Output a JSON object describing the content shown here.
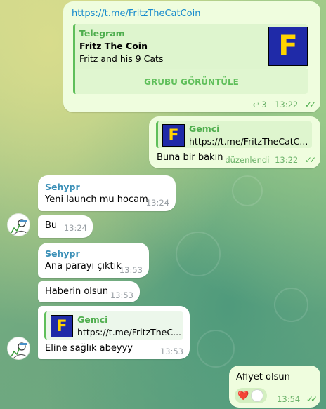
{
  "messages": {
    "m1": {
      "link": "https://t.me/FritzTheCatCoin",
      "preview_site": "Telegram",
      "preview_title": "Fritz The Coin",
      "preview_desc": "Fritz and his 9 Cats",
      "action": "GRUBU GÖRÜNTÜLE",
      "replies": "3",
      "time": "13:22",
      "logo_letter": "F"
    },
    "m2": {
      "reply_name": "Gemci",
      "reply_text": "https://t.me/FritzTheCatC...",
      "text": "Buna bir bakın",
      "edited": "düzenlendi",
      "time": "13:22",
      "logo_letter": "F"
    },
    "m3": {
      "name": "Sehypr",
      "text": "Yeni launch mu hocam",
      "time": "13:24"
    },
    "m4": {
      "text": "Bu",
      "time": "13:24"
    },
    "m5": {
      "name": "Sehypr",
      "text": "Ana parayı çıktık",
      "time": "13:53"
    },
    "m6": {
      "text": "Haberin olsun",
      "time": "13:53"
    },
    "m7": {
      "reply_name": "Gemci",
      "reply_text": "https://t.me/FritzTheC...",
      "text": "Eline sağlık abeyyy",
      "time": "13:53",
      "logo_letter": "F"
    },
    "m8": {
      "text": "Afiyet olsun",
      "reaction": "❤️",
      "time": "13:54"
    }
  },
  "colors": {
    "outgoing": "#effdde",
    "incoming": "#ffffff",
    "link": "#168acd",
    "accent_green": "#4fae4e",
    "sender_name": "#3a8fb7",
    "logo_bg": "#1f2aa8",
    "logo_fg": "#ffd400"
  }
}
